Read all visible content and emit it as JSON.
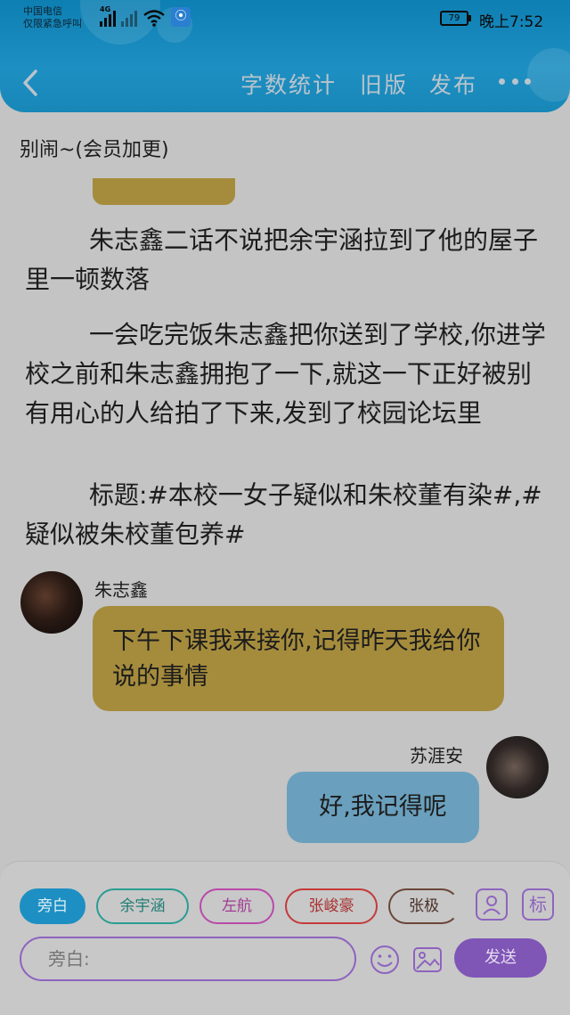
{
  "statusbar": {
    "carrier_line1": "中国电信",
    "carrier_line2": "仅限紧急呼叫",
    "network": "4G",
    "battery": "79",
    "time": "晚上7:52"
  },
  "toolbar": {
    "word_count": "字数统计",
    "old_version": "旧版",
    "publish": "发布"
  },
  "book": {
    "title": "别闹~(会员加更)"
  },
  "paragraphs": [
    "朱志鑫二话不说把余宇涵拉到了他的屋子里一顿数落",
    "一会吃完饭朱志鑫把你送到了学校,你进学校之前和朱志鑫拥抱了一下,就这一下正好被别有用心的人给拍了下来,发到了校园论坛里",
    "标题:#本校一女子疑似和朱校董有染#,#疑似被朱校董包养#"
  ],
  "messages": [
    {
      "speaker": "朱志鑫",
      "text": "下午下课我来接你,记得昨天我给你说的事情"
    },
    {
      "speaker": "苏涯安",
      "text": "好,我记得呢"
    }
  ],
  "composer": {
    "role_chips": [
      "旁白",
      "余宇涵",
      "左航",
      "张峻豪",
      "张极"
    ],
    "input_placeholder": "旁白:",
    "send_label": "发送",
    "tag_label": "标"
  },
  "colors": {
    "header": "#1887b8",
    "narration_bubble": "#a58c3c",
    "reply_bubble": "#6aa0bd",
    "accent_purple": "#7f55b6",
    "chip_active": "#1e8fc2",
    "chip_teal": "#2a9c92",
    "chip_pink": "#b84aa8",
    "chip_red": "#c43a3a",
    "chip_brown": "#6a4638"
  }
}
